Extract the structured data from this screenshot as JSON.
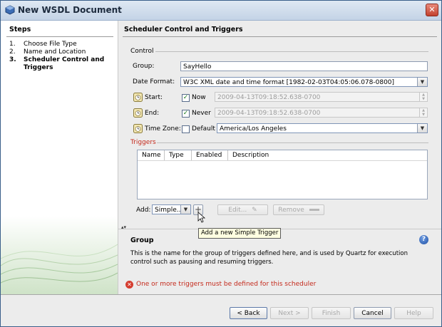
{
  "window": {
    "title": "New WSDL Document",
    "close_glyph": "✕"
  },
  "steps": {
    "title": "Steps",
    "items": [
      {
        "num": "1.",
        "label": "Choose File Type"
      },
      {
        "num": "2.",
        "label": "Name and Location"
      },
      {
        "num": "3.",
        "label": "Scheduler Control and Triggers"
      }
    ]
  },
  "panel": {
    "title": "Scheduler Control and Triggers",
    "control_label": "Control",
    "group": {
      "label": "Group:",
      "value": "SayHello"
    },
    "date_format": {
      "label": "Date Format:",
      "value": "W3C XML date and time format [1982-02-03T04:05:06.078-0800]"
    },
    "start": {
      "label": "Start:",
      "checkbox_label": "Now",
      "checked": true,
      "value": "2009-04-13T09:18:52.638-0700"
    },
    "end": {
      "label": "End:",
      "checkbox_label": "Never",
      "checked": true,
      "value": "2009-04-13T09:18:52.638-0700"
    },
    "time_zone": {
      "label": "Time Zone:",
      "checkbox_label": "Default",
      "checked": false,
      "value": "America/Los Angeles"
    },
    "triggers_label": "Triggers",
    "table_columns": [
      "Name",
      "Type",
      "Enabled",
      "Description"
    ],
    "add_label": "Add:",
    "add_type": "Simple...",
    "add_button_glyph": "+",
    "edit_label": "Edit...",
    "remove_label": "Remove",
    "tooltip": "Add a new Simple Trigger",
    "divider_glyph": "▴▾"
  },
  "help": {
    "title": "Group",
    "text": "This is the name for the group of triggers defined here, and is used by Quartz for execution control such as pausing and resuming triggers.",
    "icon": "question-icon"
  },
  "error": {
    "text": "One or more triggers must be defined for this scheduler"
  },
  "footer": {
    "back": "< Back",
    "next": "Next >",
    "finish": "Finish",
    "cancel": "Cancel",
    "help": "Help"
  },
  "colors": {
    "accent": "#c4291b",
    "triggers_label": "#c4291b"
  }
}
